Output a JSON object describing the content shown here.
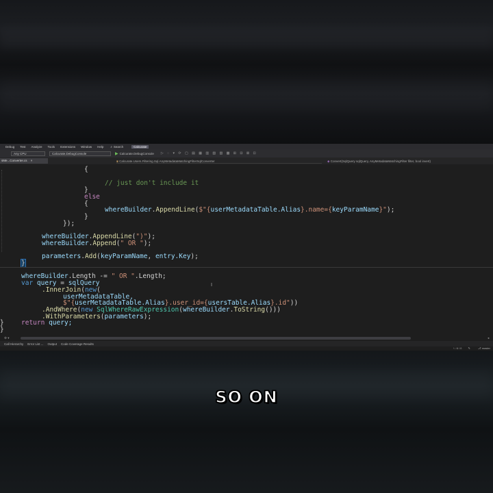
{
  "menu": {
    "items": [
      "Debug",
      "Test",
      "Analyze",
      "Tools",
      "Extensions",
      "Window",
      "Help"
    ],
    "search": "Search",
    "profile": "Calcurate"
  },
  "toolbar": {
    "platform": "Any CPU",
    "startup_project": "Calcurate.DebugConsole",
    "run_target": "Calcurate.DebugConsole"
  },
  "tabs": {
    "active_file": "sMe...Converter.cs",
    "nav_class": "Calcurate.Users.Filtering.Sql.AnyMetadataMatchingFilterSqlConverter",
    "nav_method": "Convert(SqlQuery sqlQuery, AnyMetadataMatchingFilter filter, bool invert)"
  },
  "code": {
    "l1": "{",
    "l2_comment": "// just don't include it",
    "l3": "}",
    "l4_kw": "else",
    "l5": "{",
    "l6_var": "whereBuilder",
    "l6_meth": "AppendLine",
    "l6_str_a": "$\"{",
    "l6_interp_a": "userMetadataTable.Alias",
    "l6_str_b": "}.name={",
    "l6_interp_b": "keyParamName",
    "l6_str_c": "}\"",
    "l6_end": ");",
    "l7": "}",
    "l8": "});",
    "l9_var": "whereBuilder",
    "l9_meth": "AppendLine",
    "l9_str": "\")\"",
    "l9_end": ");",
    "l10_var": "whereBuilder",
    "l10_meth": "Append",
    "l10_str": "\" OR \"",
    "l10_end": ");",
    "l11_var": "parameters",
    "l11_meth": "Add",
    "l11_arg_a": "keyParamName",
    "l11_arg_b": "entry.Key",
    "l11_end": ");",
    "l12": "}",
    "l13_var": "whereBuilder",
    "l13_mid": ".Length -= ",
    "l13_str": "\" OR \"",
    "l13_end": ".Length;",
    "l14_kw": "var",
    "l14_var": "query",
    "l14_rest": "sqlQuery",
    "l15_meth": ".InnerJoin",
    "l15_kw": "new",
    "l16_var": "userMetadataTable,",
    "l17_str_a": "$\"{",
    "l17_interp_a": "userMetadataTable.Alias",
    "l17_str_b": "}.user_id={",
    "l17_interp_b": "usersTable.Alias",
    "l17_str_c": "}.id\"",
    "l17_end": "))",
    "l18_meth": ".AndWhere",
    "l18_kw": "new",
    "l18_type": "SqlWhereRawExpression",
    "l18_var": "whereBuilder",
    "l18_meth2": "ToString",
    "l18_end": "()))",
    "l19_meth": ".WithParameters",
    "l19_var": "parameters",
    "l19_end": ");",
    "l20": "}",
    "l21_kw": "return",
    "l21_var": "query;"
  },
  "bottom_tabs": [
    "Call Hierarchy",
    "Error List ...",
    "Output",
    "Code Coverage Results"
  ],
  "status": {
    "position": "6 / 0",
    "branch": "master"
  },
  "caption": "SO ON"
}
